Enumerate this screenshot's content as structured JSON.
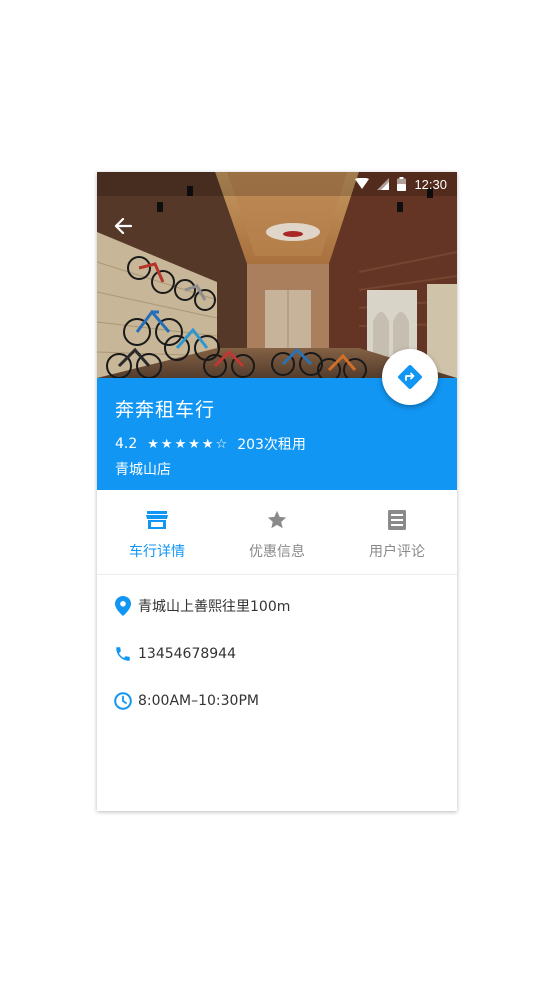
{
  "status_bar": {
    "time": "12:30"
  },
  "shop": {
    "name": "奔奔租车行",
    "rating": "4.2",
    "stars": [
      "★",
      "★",
      "★",
      "★",
      "★",
      "☆"
    ],
    "rent_count": "203次租用",
    "branch": "青城山店"
  },
  "tabs": [
    {
      "label": "车行详情",
      "icon": "store-icon",
      "active": true
    },
    {
      "label": "优惠信息",
      "icon": "star-icon",
      "active": false
    },
    {
      "label": "用户评论",
      "icon": "list-document-icon",
      "active": false
    }
  ],
  "details": {
    "address": "青城山上善熙往里100m",
    "phone": "13454678944",
    "hours": "8:00AM–10:30PM"
  },
  "colors": {
    "primary": "#1296f3",
    "tab_inactive": "#8a8a8a",
    "text": "#333333"
  }
}
